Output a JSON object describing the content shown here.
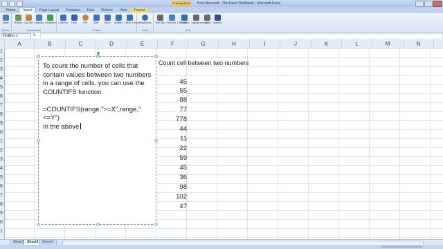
{
  "window": {
    "title": "How Microsoft - The Excel Workbook - Microsoft Excel",
    "tool_tab": "Drawing Tools"
  },
  "tabs": [
    "Home",
    "Insert",
    "Page Layout",
    "Formulas",
    "Data",
    "Review",
    "View",
    "Format"
  ],
  "ribbon": {
    "groups": [
      "Tables",
      "Illustrations",
      "Charts",
      "Links",
      "Text"
    ],
    "buttons": [
      {
        "label": "Table",
        "icon": "table-icon",
        "color": "#4a7fc1"
      },
      {
        "label": "Picture",
        "icon": "picture-icon",
        "color": "#6b9a4c"
      },
      {
        "label": "Clip Art",
        "icon": "clipart-icon",
        "color": "#c9862f"
      },
      {
        "label": "Shapes",
        "icon": "shapes-icon",
        "color": "#4a7fc1"
      },
      {
        "label": "SmartArt",
        "icon": "smartart-icon",
        "color": "#3da04a"
      },
      {
        "label": "Column",
        "icon": "column-chart-icon",
        "color": "#3a6fc2"
      },
      {
        "label": "Line",
        "icon": "line-chart-icon",
        "color": "#2e66b8"
      },
      {
        "label": "Pie",
        "icon": "pie-chart-icon",
        "color": "#d2812c"
      },
      {
        "label": "Bar",
        "icon": "bar-chart-icon",
        "color": "#3a6fc2"
      },
      {
        "label": "Area",
        "icon": "area-chart-icon",
        "color": "#3a6fc2"
      },
      {
        "label": "Scatter",
        "icon": "scatter-chart-icon",
        "color": "#3a6fc2"
      },
      {
        "label": "Other Charts",
        "icon": "other-charts-icon",
        "color": "#3a6fc2"
      },
      {
        "label": "Hyperlink",
        "icon": "hyperlink-icon",
        "color": "#2f6fb3"
      },
      {
        "label": "Text Box",
        "icon": "textbox-icon",
        "color": "#6a6a6a"
      },
      {
        "label": "Header & Footer",
        "icon": "header-footer-icon",
        "color": "#4a7fc1"
      },
      {
        "label": "WordArt",
        "icon": "wordart-icon",
        "color": "#2f6fb3"
      },
      {
        "label": "Signature Line",
        "icon": "signature-icon",
        "color": "#6a6a6a"
      },
      {
        "label": "Object",
        "icon": "object-icon",
        "color": "#6a6a6a"
      },
      {
        "label": "Symbol",
        "icon": "symbol-icon",
        "color": "#2f4f8f"
      }
    ]
  },
  "formula_bar": {
    "name_box": "TextBox 1",
    "fx": "fx",
    "formula": ""
  },
  "columns": [
    "A",
    "B",
    "C",
    "D",
    "E",
    "F",
    "G",
    "H",
    "I",
    "J",
    "K",
    "L",
    "M",
    "N"
  ],
  "rows": [
    "1",
    "2",
    "3",
    "4",
    "5",
    "6",
    "7",
    "8",
    "9",
    "0",
    "1",
    "2",
    "3",
    "4",
    "5",
    "6",
    "7",
    "8",
    "9",
    "0",
    "1",
    "2"
  ],
  "textbox": {
    "lines": [
      "To count the number of cells that",
      "contain values between two numbers",
      "in a range of cells, you can use the",
      "COUNTIFS function",
      "",
      "=COUNTIFS(range,\">=X\",range,\"<=Y\")",
      "In the above"
    ]
  },
  "sheet": {
    "heading": "Count cell between two numbers",
    "values": [
      45,
      55,
      88,
      77,
      778,
      44,
      11,
      22,
      59,
      45,
      36,
      98,
      102,
      47
    ]
  },
  "sheet_tabs": [
    "Sheet1",
    "Sheet2",
    "Sheet3"
  ],
  "active_sheet": "Sheet2"
}
